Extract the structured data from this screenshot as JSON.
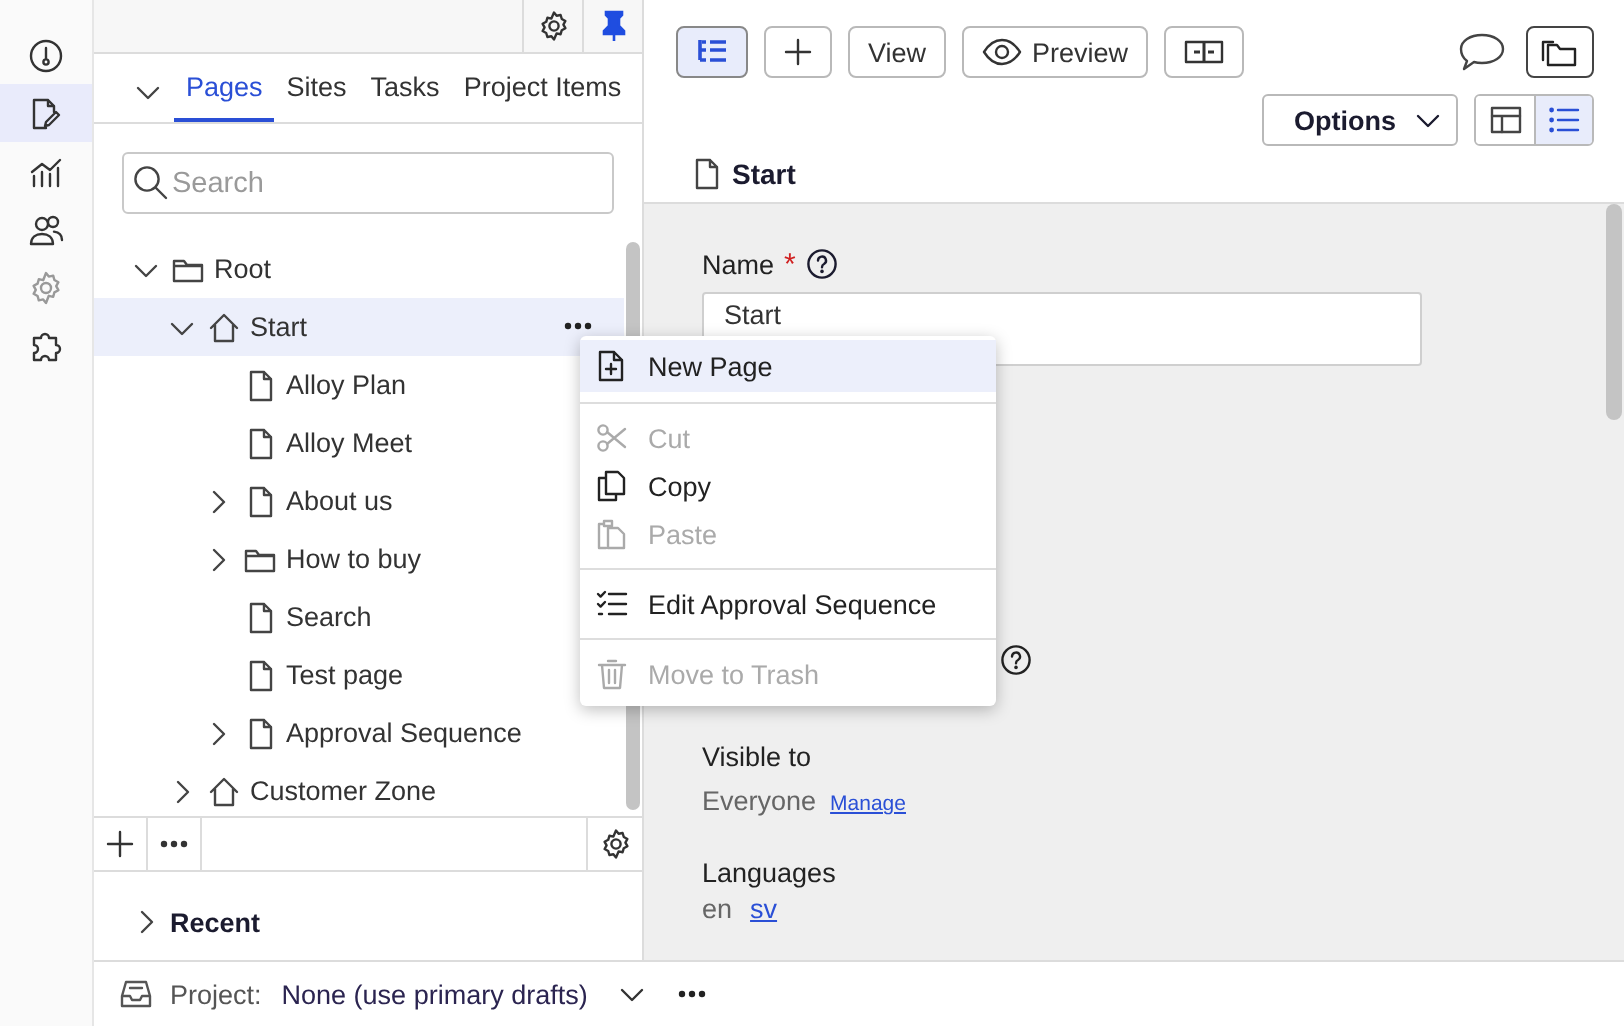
{
  "rail": [
    {
      "selected": false
    },
    {
      "selected": true
    },
    {
      "selected": false
    },
    {
      "selected": false
    },
    {
      "selected": false
    },
    {
      "selected": false
    }
  ],
  "nav": {
    "tabs": [
      {
        "label": "Pages",
        "selected": true
      },
      {
        "label": "Sites",
        "selected": false
      },
      {
        "label": "Tasks",
        "selected": false
      },
      {
        "label": "Project Items",
        "selected": false
      }
    ],
    "search": {
      "placeholder": "Search"
    },
    "tree": [
      {
        "label": "Root",
        "kind": "folder",
        "expanded": true,
        "selected": false,
        "children": [
          {
            "label": "Start",
            "kind": "home",
            "expanded": true,
            "selected": true,
            "children": [
              {
                "label": "Alloy Plan",
                "kind": "page",
                "selected": false
              },
              {
                "label": "Alloy Meet",
                "kind": "page",
                "selected": false
              },
              {
                "label": "About us",
                "kind": "page",
                "expanded": false,
                "selected": false
              },
              {
                "label": "How to buy",
                "kind": "folder",
                "expanded": false,
                "selected": false
              },
              {
                "label": "Search",
                "kind": "page",
                "selected": false
              },
              {
                "label": "Test page",
                "kind": "page",
                "selected": false
              },
              {
                "label": "Approval Sequence",
                "kind": "page",
                "expanded": false,
                "selected": false
              }
            ]
          },
          {
            "label": "Customer Zone",
            "kind": "home",
            "expanded": false,
            "selected": false
          }
        ]
      }
    ],
    "recent": {
      "label": "Recent",
      "expanded": false
    }
  },
  "toolbar": [
    {
      "kind": "tree",
      "selected": true
    },
    {
      "kind": "add",
      "selected": false
    },
    {
      "kind": "text",
      "label": "View",
      "selected": false
    },
    {
      "kind": "preview",
      "label": "Preview",
      "selected": false
    },
    {
      "kind": "compare",
      "selected": false
    }
  ],
  "options": {
    "label": "Options"
  },
  "view_toggle": [
    {
      "selected": false
    },
    {
      "selected": true
    }
  ],
  "page_title": "Start",
  "form": {
    "name_label": "Name",
    "required_mark": "*",
    "name_value": "Start",
    "visible_to_label": "Visible to",
    "visible_to_value": "Everyone",
    "manage_link": "Manage",
    "languages_label": "Languages",
    "languages": [
      {
        "code": "en",
        "link": false
      },
      {
        "code": "sv",
        "link": true
      }
    ]
  },
  "menu": [
    {
      "kind": "item",
      "label": "New Page",
      "disabled": false,
      "selected": true
    },
    {
      "kind": "separator"
    },
    {
      "kind": "item",
      "label": "Cut",
      "disabled": true,
      "selected": false
    },
    {
      "kind": "item",
      "label": "Copy",
      "disabled": false,
      "selected": false
    },
    {
      "kind": "item",
      "label": "Paste",
      "disabled": true,
      "selected": false
    },
    {
      "kind": "separator"
    },
    {
      "kind": "item",
      "label": "Edit Approval Sequence",
      "disabled": false,
      "selected": false
    },
    {
      "kind": "separator"
    },
    {
      "kind": "item",
      "label": "Move to Trash",
      "disabled": true,
      "selected": false
    }
  ],
  "project": {
    "label": "Project:",
    "value": "None (use primary drafts)"
  }
}
